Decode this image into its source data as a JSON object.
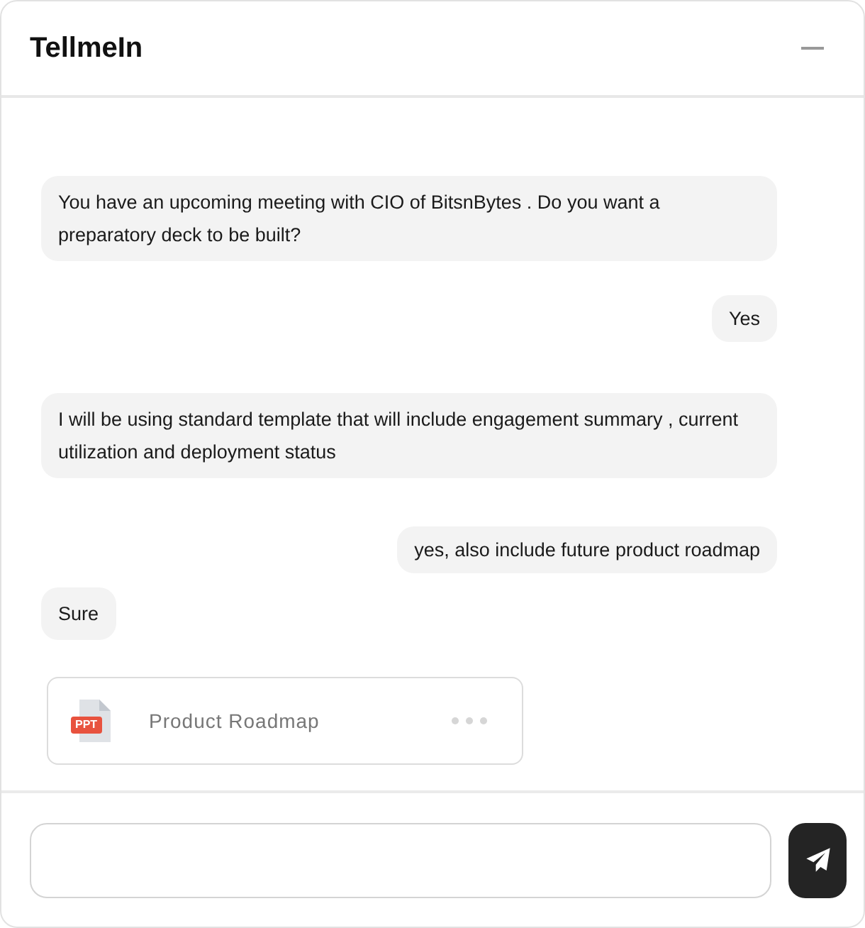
{
  "window": {
    "title": "TellmeIn"
  },
  "messages": [
    {
      "kind": "bot",
      "text": "You have an upcoming meeting with CIO of BitsnBytes . Do you want a preparatory deck to be built?"
    },
    {
      "kind": "user",
      "text": "Yes"
    },
    {
      "kind": "bot",
      "text": "I will be using standard template that will include engagement summary , current utilization and deployment status"
    },
    {
      "kind": "user",
      "text": "yes, also include future product roadmap"
    },
    {
      "kind": "bot",
      "text": "Sure"
    },
    {
      "kind": "file",
      "file_type": "PPT",
      "name": "Product Roadmap"
    }
  ]
}
